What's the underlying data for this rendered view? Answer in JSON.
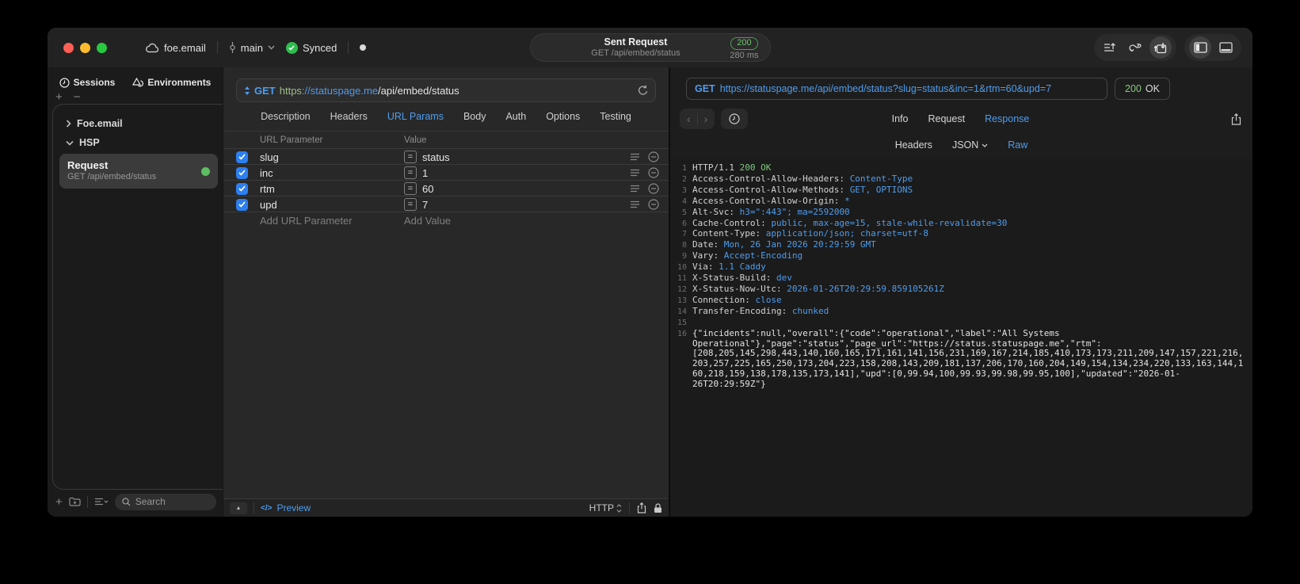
{
  "colors": {
    "accent_blue": "#4f9ded",
    "success_green": "#6fc76f",
    "checkbox_blue": "#2d7ff0"
  },
  "titlebar": {
    "workspace": "foe.email",
    "branch": "main",
    "sync_label": "Synced",
    "request_pill": {
      "title": "Sent Request",
      "subtitle": "GET /api/embed/status",
      "status_code": "200",
      "duration": "280 ms"
    }
  },
  "sidebar": {
    "tabs": [
      {
        "label": "Sessions"
      },
      {
        "label": "Environments"
      }
    ],
    "add_label": "+",
    "remove_label": "−",
    "tree": [
      {
        "label": "Foe.email"
      },
      {
        "label": "HSP"
      }
    ],
    "request_item": {
      "title": "Request",
      "subtitle": "GET /api/embed/status"
    },
    "search_placeholder": "Search"
  },
  "request_editor": {
    "method": "GET",
    "url": {
      "scheme": "https",
      "host": "://statuspage.me",
      "path": "/api/embed/status"
    },
    "tabs": [
      "Description",
      "Headers",
      "URL Params",
      "Body",
      "Auth",
      "Options",
      "Testing"
    ],
    "active_tab": "URL Params",
    "params": {
      "columns": [
        "URL Parameter",
        "Value"
      ],
      "rows": [
        {
          "name": "slug",
          "value": "status",
          "enabled": true
        },
        {
          "name": "inc",
          "value": "1",
          "enabled": true
        },
        {
          "name": "rtm",
          "value": "60",
          "enabled": true
        },
        {
          "name": "upd",
          "value": "7",
          "enabled": true
        }
      ],
      "equals_glyph": "=",
      "add_name": "Add URL Parameter",
      "add_value": "Add Value"
    },
    "footer": {
      "preview": "Preview",
      "code_glyph": "</>",
      "protocol": "HTTP"
    }
  },
  "response": {
    "method": "GET",
    "url": "https://statuspage.me/api/embed/status?slug=status&inc=1&rtm=60&upd=7",
    "status_code": "200",
    "status_text": "OK",
    "tabs": [
      "Info",
      "Request",
      "Response"
    ],
    "active_tab": "Response",
    "subtabs": [
      "Headers",
      "JSON",
      "Raw"
    ],
    "active_subtab": "Raw",
    "body": {
      "status_line": {
        "protocol": "HTTP/1.1",
        "status": "200 OK"
      },
      "headers": [
        {
          "name": "Access-Control-Allow-Headers",
          "value": "Content-Type"
        },
        {
          "name": "Access-Control-Allow-Methods",
          "value": "GET, OPTIONS"
        },
        {
          "name": "Access-Control-Allow-Origin",
          "value": "*"
        },
        {
          "name": "Alt-Svc",
          "value": "h3=\":443\"; ma=2592000"
        },
        {
          "name": "Cache-Control",
          "value": "public, max-age=15, stale-while-revalidate=30"
        },
        {
          "name": "Content-Type",
          "value": "application/json; charset=utf-8"
        },
        {
          "name": "Date",
          "value": "Mon, 26 Jan 2026 20:29:59 GMT"
        },
        {
          "name": "Vary",
          "value": "Accept-Encoding"
        },
        {
          "name": "Via",
          "value": "1.1 Caddy"
        },
        {
          "name": "X-Status-Build",
          "value": "dev"
        },
        {
          "name": "X-Status-Now-Utc",
          "value": "2026-01-26T20:29:59.859105261Z"
        },
        {
          "name": "Connection",
          "value": "close"
        },
        {
          "name": "Transfer-Encoding",
          "value": "chunked"
        }
      ],
      "json_body": "{\"incidents\":null,\"overall\":{\"code\":\"operational\",\"label\":\"All Systems Operational\"},\"page\":\"status\",\"page_url\":\"https://status.statuspage.me\",\"rtm\":[208,205,145,298,443,140,160,165,171,161,141,156,231,169,167,214,185,410,173,173,211,209,147,157,221,216,203,257,225,165,250,173,204,223,158,208,143,209,181,137,206,170,160,204,149,154,134,234,220,133,163,144,160,218,159,138,178,135,173,141],\"upd\":[0,99.94,100,99.93,99.98,99.95,100],\"updated\":\"2026-01-26T20:29:59Z\"}"
    }
  }
}
